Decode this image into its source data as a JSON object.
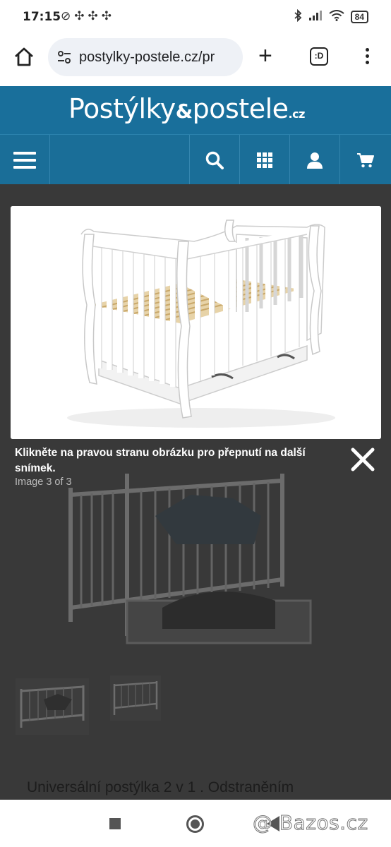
{
  "status_bar": {
    "time": "17:15",
    "left_icons": "⊘✣✣✣",
    "battery": "84"
  },
  "browser": {
    "url": "postylky-postele.cz/pr",
    "tabs_label": ":D"
  },
  "site": {
    "logo_part1": "Postýlky",
    "logo_amp": "&",
    "logo_part2": "postele",
    "logo_tld": ".cz",
    "brand_color": "#196f9b"
  },
  "lightbox": {
    "caption": "Klikněte na pravou stranu obrázku pro přepnutí na další snímek.",
    "counter": "Image 3 of 3"
  },
  "page": {
    "product_text_partial": "Universální postýlka 2 v 1 . Odstraněním"
  },
  "watermark": "@ Bazos.cz"
}
